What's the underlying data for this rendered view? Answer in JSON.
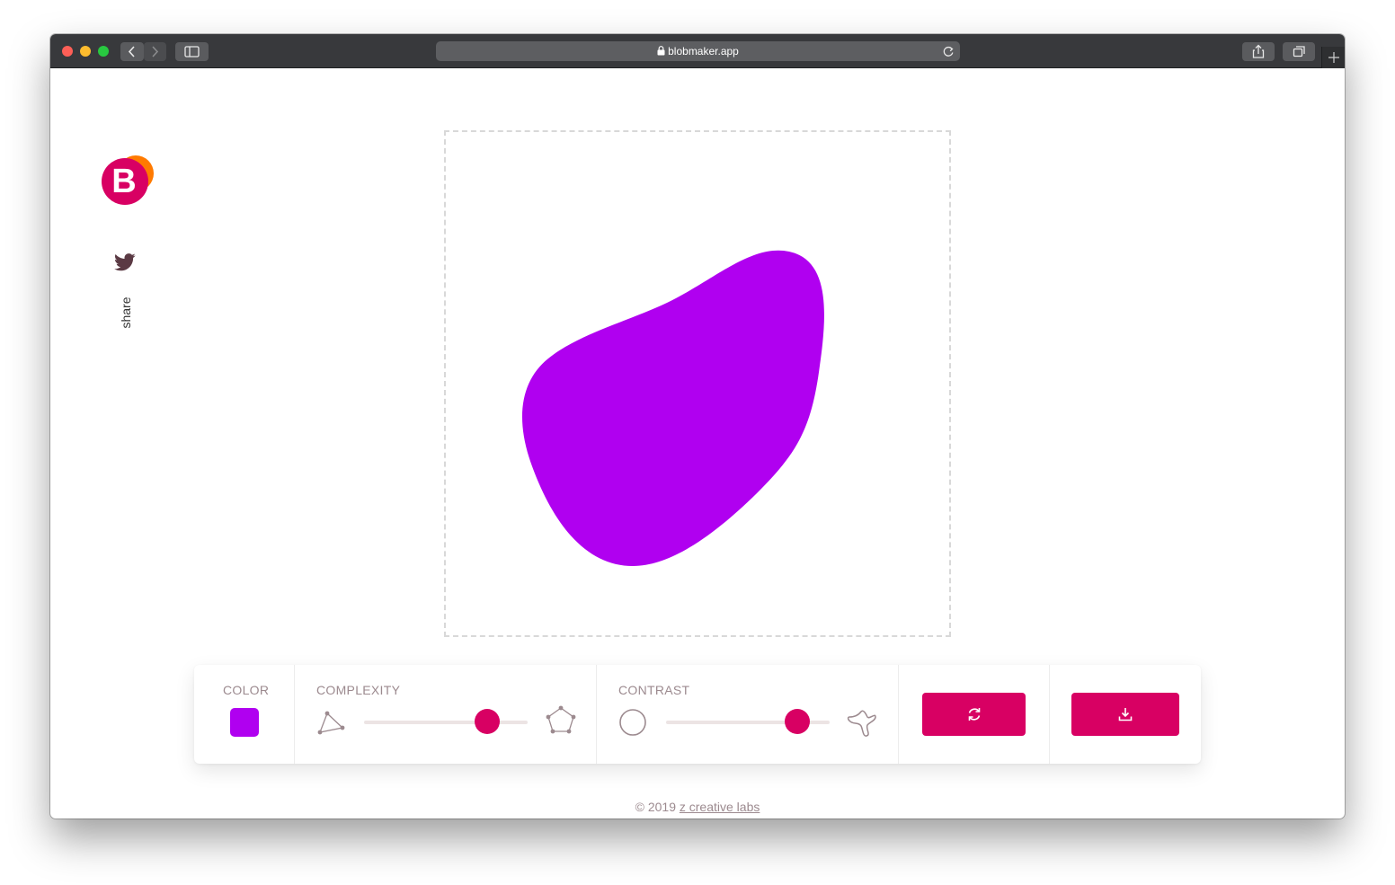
{
  "browser": {
    "url": "blobmaker.app"
  },
  "sidebar": {
    "share_label": "share"
  },
  "blob": {
    "color": "#b000f0"
  },
  "controls": {
    "color_label": "COLOR",
    "complexity_label": "COMPLEXITY",
    "complexity_value": 0.75,
    "contrast_label": "CONTRAST",
    "contrast_value": 0.8
  },
  "footer": {
    "copyright": "© 2019 ",
    "link_text": "z creative labs"
  },
  "colors": {
    "accent": "#d80063",
    "logo_orange": "#ff7a00"
  },
  "icons": {
    "regenerate": "refresh-icon",
    "download": "download-icon",
    "twitter": "twitter-icon"
  }
}
